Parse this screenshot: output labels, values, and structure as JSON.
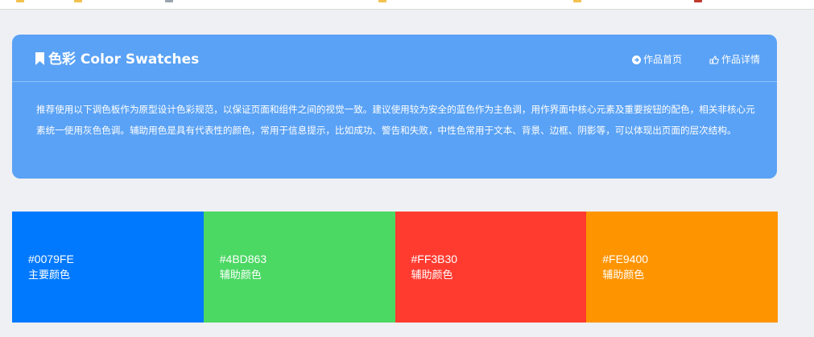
{
  "card": {
    "title": "色彩 Color Swatches",
    "nav": {
      "home_label": "作品首页",
      "detail_label": "作品详情"
    },
    "description": "推荐使用以下调色板作为原型设计色彩规范，以保证页面和组件之间的视觉一致。建议使用较为安全的蓝色作为主色调，用作界面中核心元素及重要按钮的配色，相关非核心元素统一使用灰色色调。辅助用色是具有代表性的颜色，常用于信息提示，比如成功、警告和失败，中性色常用于文本、背景、边框、阴影等，可以体现出页面的层次结构。",
    "background_color": "#5AA2F5"
  },
  "swatches": [
    {
      "hex": "#0079FE",
      "role": "主要颜色",
      "color": "#0079FE"
    },
    {
      "hex": "#4BD863",
      "role": "辅助颜色",
      "color": "#4BD863"
    },
    {
      "hex": "#FF3B30",
      "role": "辅助颜色",
      "color": "#FF3B30"
    },
    {
      "hex": "#FE9400",
      "role": "辅助颜色",
      "color": "#FE9400"
    }
  ]
}
